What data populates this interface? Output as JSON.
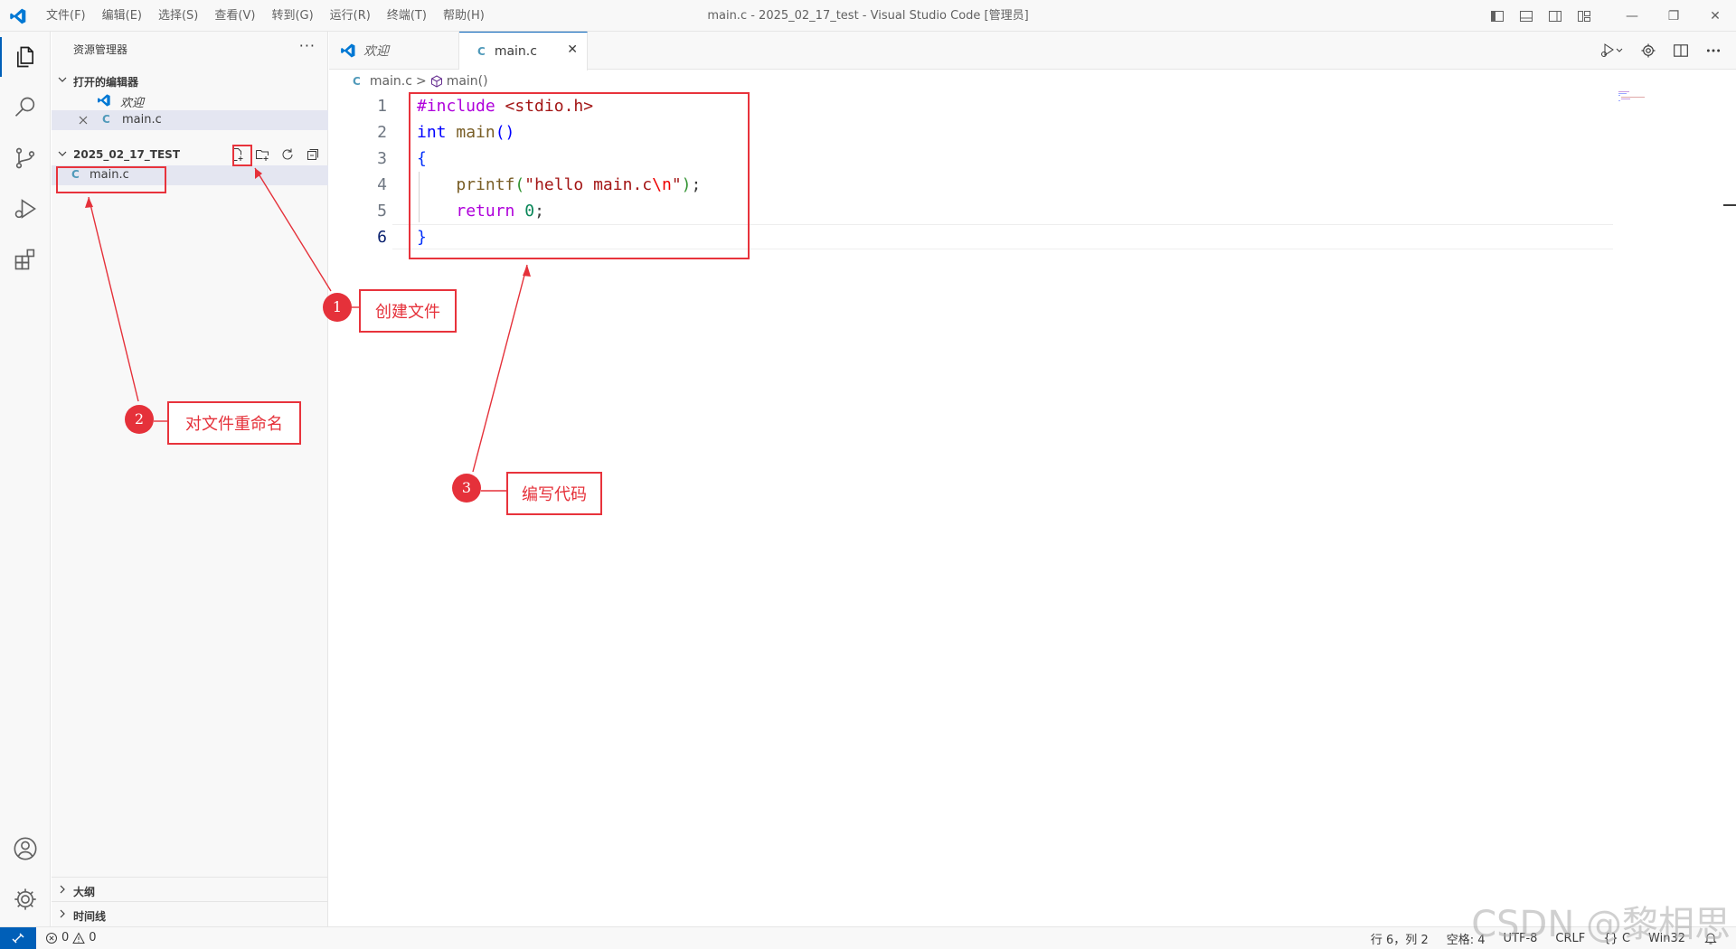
{
  "window": {
    "title": "main.c - 2025_02_17_test - Visual Studio Code [管理员]",
    "menu": [
      "文件(F)",
      "编辑(E)",
      "选择(S)",
      "查看(V)",
      "转到(G)",
      "运行(R)",
      "终端(T)",
      "帮助(H)"
    ],
    "controls": {
      "minimize": "—",
      "restore": "❐",
      "close": "✕"
    }
  },
  "activity_bar": {
    "items": [
      "explorer-icon",
      "search-icon",
      "source-control-icon",
      "run-debug-icon",
      "extensions-icon"
    ],
    "bottom": [
      "account-icon",
      "settings-gear-icon"
    ]
  },
  "sidebar": {
    "title": "资源管理器",
    "more": "···",
    "open_editors": {
      "label": "打开的编辑器",
      "items": [
        {
          "name": "欢迎",
          "icon": "vscode-icon"
        },
        {
          "name": "main.c",
          "icon": "C"
        }
      ]
    },
    "folder": {
      "label": "2025_02_17_TEST",
      "files": [
        {
          "icon": "C",
          "name": "main.c"
        }
      ]
    },
    "outline": "大纲",
    "timeline": "时间线"
  },
  "editor": {
    "tabs": [
      {
        "label": "欢迎",
        "icon": "vscode-icon"
      },
      {
        "label": "main.c",
        "icon": "C",
        "close": "✕"
      }
    ],
    "breadcrumb": {
      "file_icon": "C",
      "file": "main.c",
      "separator": ">",
      "symbol": "main()"
    },
    "line_numbers": [
      "1",
      "2",
      "3",
      "4",
      "5",
      "6"
    ],
    "code": {
      "l1": {
        "directive": "#include",
        "header": "<stdio.h>"
      },
      "l2": {
        "type": "int",
        "fn": "main",
        "parens": "()"
      },
      "l3": {
        "brace": "{"
      },
      "l4": {
        "indent": "    ",
        "fn": "printf",
        "open": "(",
        "str1": "\"hello main.c",
        "esc": "\\n",
        "str2": "\"",
        "close": ")",
        "semi": ";"
      },
      "l5": {
        "indent": "    ",
        "kw": "return",
        "num": "0",
        "semi": ";"
      },
      "l6": {
        "brace": "}"
      }
    }
  },
  "annotations": [
    {
      "number": "1",
      "text": "创建文件"
    },
    {
      "number": "2",
      "text": "对文件重命名"
    },
    {
      "number": "3",
      "text": "编写代码"
    }
  ],
  "statusbar": {
    "errors": "0",
    "warnings": "0",
    "position": "行 6，列 2",
    "spaces": "空格: 4",
    "encoding": "UTF-8",
    "eol": "CRLF",
    "language_braces": "{}",
    "language": "C",
    "platform": "Win32"
  },
  "watermark": "CSDN @黎相思",
  "colors": {
    "accent": "#005fb8",
    "annotation": "#e5313a"
  }
}
